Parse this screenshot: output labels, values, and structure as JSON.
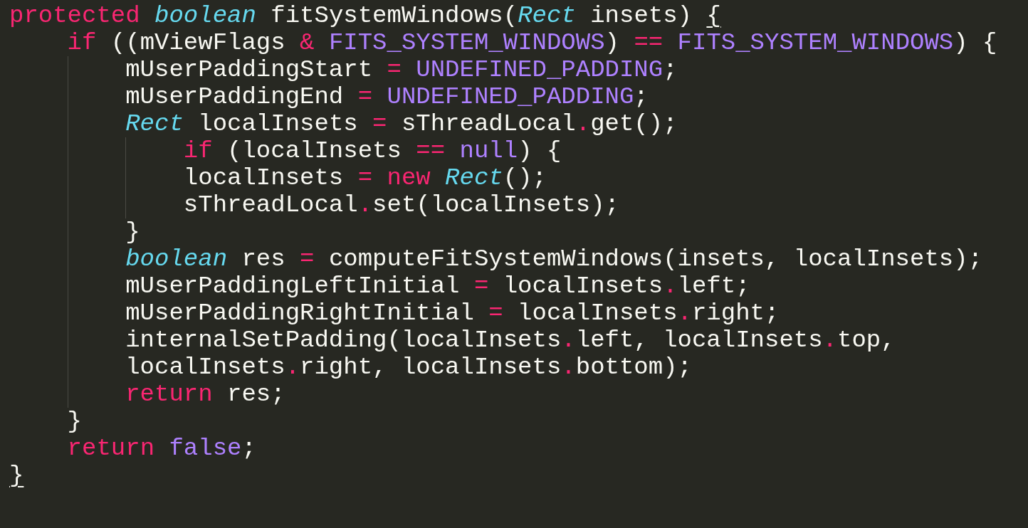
{
  "editor": {
    "lines": [
      {
        "tokens": [
          {
            "kind": "keyword",
            "text": "protected "
          },
          {
            "kind": "type",
            "text": "boolean"
          },
          {
            "kind": "plain",
            "text": " fitSystemWindows("
          },
          {
            "kind": "type",
            "text": "Rect"
          },
          {
            "kind": "plain",
            "text": " insets) "
          },
          {
            "kind": "matched",
            "text": "{"
          }
        ]
      },
      {
        "tokens": [
          {
            "kind": "keyword",
            "text": "    if"
          },
          {
            "kind": "plain",
            "text": " ((mViewFlags "
          },
          {
            "kind": "operator",
            "text": "& "
          },
          {
            "kind": "constant",
            "text": "FITS_SYSTEM_WINDOWS"
          },
          {
            "kind": "plain",
            "text": ") "
          },
          {
            "kind": "operator",
            "text": "== "
          },
          {
            "kind": "constant",
            "text": "FITS_SYSTEM_WINDOWS"
          },
          {
            "kind": "plain",
            "text": ") {"
          }
        ]
      },
      {
        "tokens": [
          {
            "kind": "plain",
            "text": "        mUserPaddingStart "
          },
          {
            "kind": "operator",
            "text": "= "
          },
          {
            "kind": "constant",
            "text": "UNDEFINED_PADDING"
          },
          {
            "kind": "plain",
            "text": ";"
          }
        ]
      },
      {
        "tokens": [
          {
            "kind": "plain",
            "text": "        mUserPaddingEnd "
          },
          {
            "kind": "operator",
            "text": "= "
          },
          {
            "kind": "constant",
            "text": "UNDEFINED_PADDING"
          },
          {
            "kind": "plain",
            "text": ";"
          }
        ]
      },
      {
        "tokens": [
          {
            "kind": "type",
            "text": "        Rect"
          },
          {
            "kind": "plain",
            "text": " localInsets "
          },
          {
            "kind": "operator",
            "text": "="
          },
          {
            "kind": "plain",
            "text": " sThreadLocal"
          },
          {
            "kind": "operator",
            "text": "."
          },
          {
            "kind": "plain",
            "text": "get();"
          }
        ]
      },
      {
        "tokens": [
          {
            "kind": "keyword",
            "text": "            if"
          },
          {
            "kind": "plain",
            "text": " (localInsets "
          },
          {
            "kind": "operator",
            "text": "== "
          },
          {
            "kind": "constant",
            "text": "null"
          },
          {
            "kind": "plain",
            "text": ") {"
          }
        ]
      },
      {
        "tokens": [
          {
            "kind": "plain",
            "text": "            localInsets "
          },
          {
            "kind": "operator",
            "text": "= "
          },
          {
            "kind": "keyword",
            "text": "new "
          },
          {
            "kind": "type",
            "text": "Rect"
          },
          {
            "kind": "plain",
            "text": "();"
          }
        ]
      },
      {
        "tokens": [
          {
            "kind": "plain",
            "text": "            sThreadLocal"
          },
          {
            "kind": "operator",
            "text": "."
          },
          {
            "kind": "plain",
            "text": "set(localInsets);"
          }
        ]
      },
      {
        "tokens": [
          {
            "kind": "plain",
            "text": "        }"
          }
        ]
      },
      {
        "tokens": [
          {
            "kind": "type",
            "text": "        boolean"
          },
          {
            "kind": "plain",
            "text": " res "
          },
          {
            "kind": "operator",
            "text": "="
          },
          {
            "kind": "plain",
            "text": " computeFitSystemWindows(insets, localInsets);"
          }
        ]
      },
      {
        "tokens": [
          {
            "kind": "plain",
            "text": "        mUserPaddingLeftInitial "
          },
          {
            "kind": "operator",
            "text": "="
          },
          {
            "kind": "plain",
            "text": " localInsets"
          },
          {
            "kind": "operator",
            "text": "."
          },
          {
            "kind": "plain",
            "text": "left;"
          }
        ]
      },
      {
        "tokens": [
          {
            "kind": "plain",
            "text": "        mUserPaddingRightInitial "
          },
          {
            "kind": "operator",
            "text": "="
          },
          {
            "kind": "plain",
            "text": " localInsets"
          },
          {
            "kind": "operator",
            "text": "."
          },
          {
            "kind": "plain",
            "text": "right;"
          }
        ]
      },
      {
        "tokens": [
          {
            "kind": "plain",
            "text": "        internalSetPadding(localInsets"
          },
          {
            "kind": "operator",
            "text": "."
          },
          {
            "kind": "plain",
            "text": "left, localInsets"
          },
          {
            "kind": "operator",
            "text": "."
          },
          {
            "kind": "plain",
            "text": "top,"
          }
        ]
      },
      {
        "tokens": [
          {
            "kind": "plain",
            "text": "        localInsets"
          },
          {
            "kind": "operator",
            "text": "."
          },
          {
            "kind": "plain",
            "text": "right, localInsets"
          },
          {
            "kind": "operator",
            "text": "."
          },
          {
            "kind": "plain",
            "text": "bottom);"
          }
        ]
      },
      {
        "tokens": [
          {
            "kind": "keyword",
            "text": "        return"
          },
          {
            "kind": "plain",
            "text": " res;"
          }
        ]
      },
      {
        "tokens": [
          {
            "kind": "plain",
            "text": "    }"
          }
        ]
      },
      {
        "tokens": [
          {
            "kind": "keyword",
            "text": "    return "
          },
          {
            "kind": "constant",
            "text": "false"
          },
          {
            "kind": "plain",
            "text": ";"
          }
        ]
      },
      {
        "tokens": [
          {
            "kind": "matched",
            "text": "}"
          }
        ]
      }
    ]
  }
}
